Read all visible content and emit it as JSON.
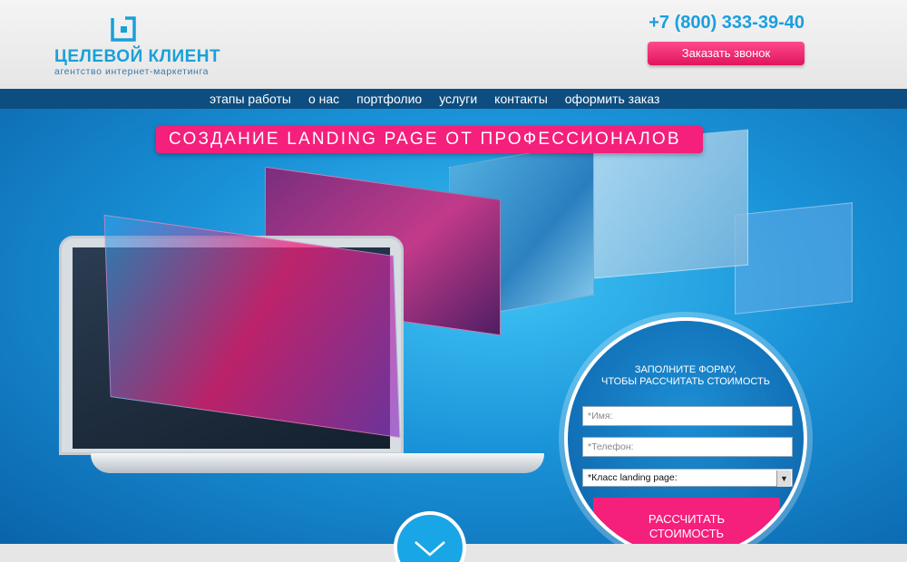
{
  "header": {
    "brand_name": "ЦЕЛЕВОЙ КЛИЕНТ",
    "brand_tagline": "агентство интернет-маркетинга",
    "phone": "+7 (800) 333-39-40",
    "call_button": "Заказать звонок"
  },
  "nav": {
    "items": [
      {
        "label": "этапы работы"
      },
      {
        "label": "о нас"
      },
      {
        "label": "портфолио"
      },
      {
        "label": "услуги"
      },
      {
        "label": "контакты"
      },
      {
        "label": "оформить заказ"
      }
    ]
  },
  "hero": {
    "title": "СОЗДАНИЕ LANDING PAGE ОТ ПРОФЕССИОНАЛОВ"
  },
  "form": {
    "heading_line1": "ЗАПОЛНИТЕ ФОРМУ,",
    "heading_line2": "ЧТОБЫ РАССЧИТАТЬ СТОИМОСТЬ",
    "name_placeholder": "*Имя:",
    "phone_placeholder": "*Телефон:",
    "class_select": "*Класс landing page:",
    "submit_line1": "РАССЧИТАТЬ",
    "submit_line2": "СТОИМОСТЬ"
  },
  "colors": {
    "accent_pink": "#f51f7c",
    "brand_blue": "#1aa0d8",
    "nav_bg": "#0d4d7f"
  },
  "icons": {
    "logo": "logo-mark-icon",
    "scroll": "chevron-down-icon",
    "select": "select-arrow-icon"
  }
}
